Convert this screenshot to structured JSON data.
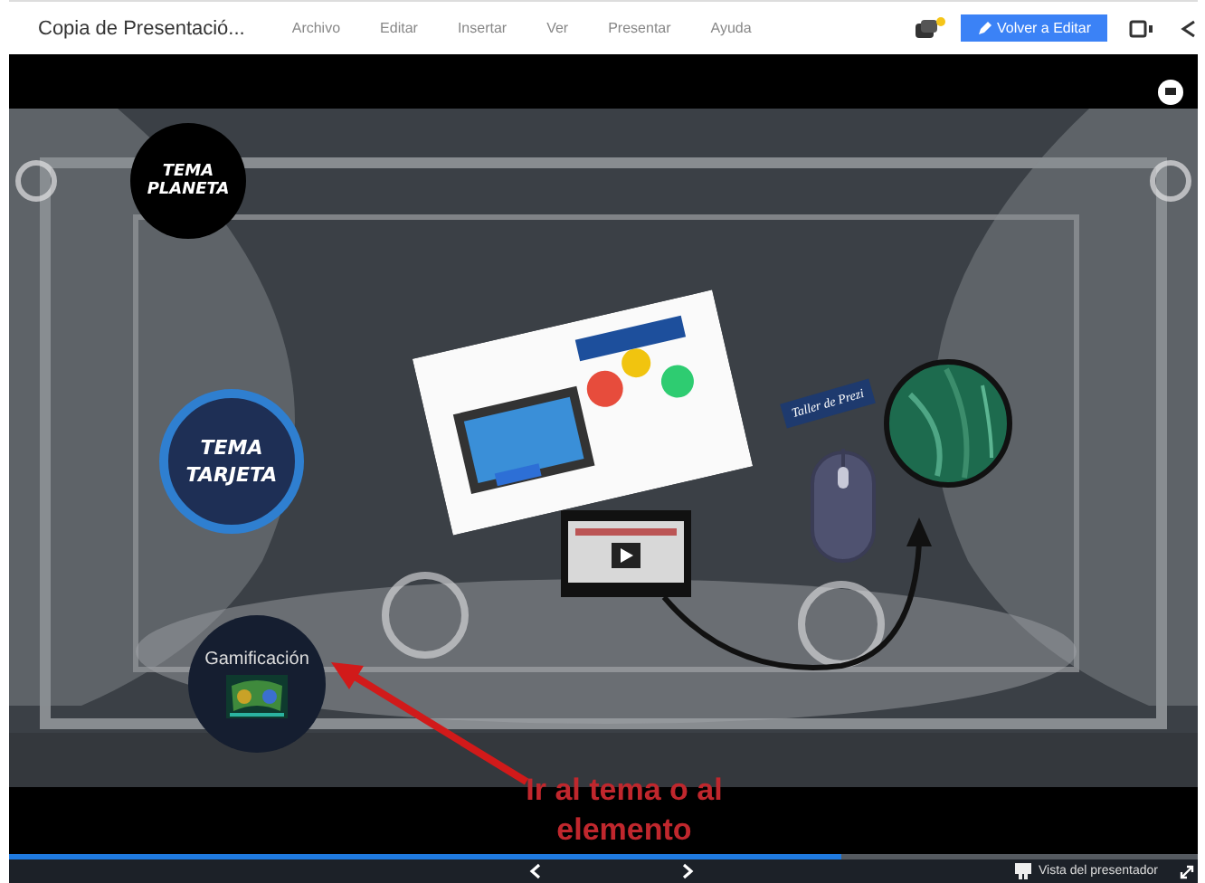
{
  "menu_bar": {
    "title": "Copia de Presentació...",
    "menus": [
      "Archivo",
      "Editar",
      "Insertar",
      "Ver",
      "Presentar",
      "Ayuda"
    ],
    "edit_button": "Volver a Editar"
  },
  "canvas": {
    "topics": [
      {
        "kind": "planet",
        "label": "TEMA PLANETA"
      },
      {
        "kind": "card",
        "label": "TEMA TARJETA"
      },
      {
        "kind": "thumbnail",
        "label": "Gamificación"
      }
    ],
    "banner": "Taller de Prezi",
    "annotation": "Ir al tema o al elemento"
  },
  "footer": {
    "progress": {
      "level": 0.7
    },
    "presenter_view": "Vista del presentador"
  }
}
